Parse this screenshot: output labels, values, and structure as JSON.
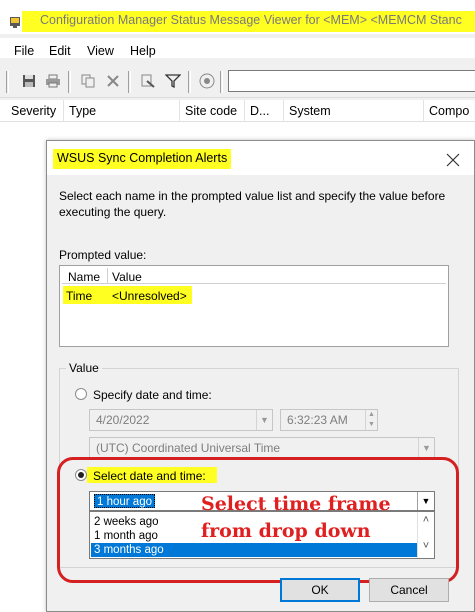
{
  "window": {
    "title": "Configuration Manager Status Message Viewer for <MEM> <MEMCM Stanc"
  },
  "menu": [
    "File",
    "Edit",
    "View",
    "Help"
  ],
  "columns": [
    "Severity",
    "Type",
    "Site code",
    "D...",
    "System",
    "Compo"
  ],
  "dialog": {
    "title": "WSUS Sync Completion Alerts",
    "instructions": "Select each name in the prompted value list and specify the value before executing the query.",
    "prompted_label": "Prompted value:",
    "prompted_columns": [
      "Name",
      "Value"
    ],
    "prompted_row": {
      "name": "Time",
      "value": "<Unresolved>"
    },
    "value_group_label": "Value",
    "specify_label": "Specify date and time:",
    "date_value": "4/20/2022",
    "time_value": "6:32:23 AM",
    "timezone_value": "(UTC) Coordinated Universal Time",
    "select_label": "Select date and time:",
    "combo_value": "1 hour ago",
    "dropdown_options": [
      "2 weeks ago",
      "1 month ago",
      "3 months ago"
    ],
    "dropdown_selected_index": 2,
    "annotation": [
      "Select time frame",
      "from drop down"
    ],
    "ok_label": "OK",
    "cancel_label": "Cancel"
  },
  "colors": {
    "highlight": "#ffff22",
    "selection": "#0078d7",
    "annotation": "#e02020",
    "ring": "#d42020"
  },
  "icons": [
    "app-icon",
    "save-icon",
    "print-icon",
    "copy-icon",
    "delete-icon",
    "properties-icon",
    "filter-icon",
    "stop-icon",
    "close-icon",
    "chevron-down-icon",
    "scroll-up-icon",
    "scroll-down-icon"
  ]
}
